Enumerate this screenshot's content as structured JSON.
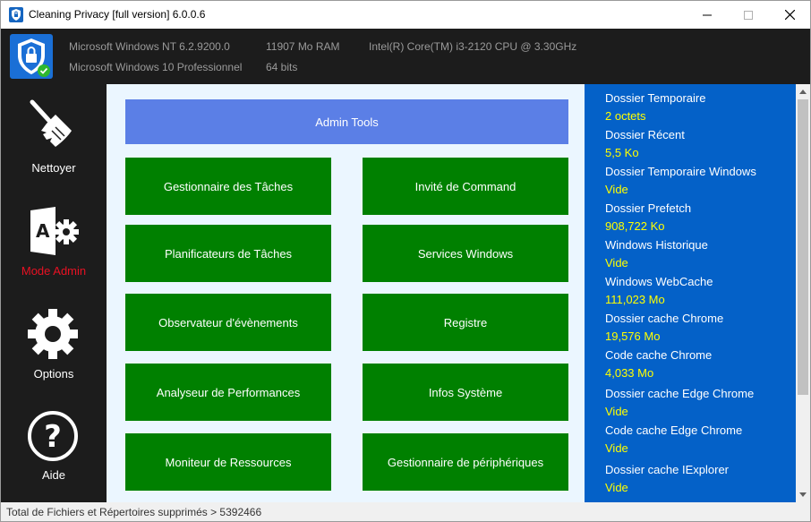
{
  "window": {
    "title": "Cleaning Privacy [full version] 6.0.0.6"
  },
  "header": {
    "os_name": "Microsoft Windows NT 6.2.9200.0",
    "os_edition": "Microsoft Windows 10 Professionnel",
    "ram": "11907 Mo RAM",
    "arch": "64 bits",
    "cpu": "Intel(R) Core(TM) i3-2120 CPU @ 3.30GHz"
  },
  "sidebar": {
    "items": [
      {
        "label": "Nettoyer",
        "icon": "broom-icon",
        "active": false
      },
      {
        "label": "Mode Admin",
        "icon": "admin-icon",
        "active": true
      },
      {
        "label": "Options",
        "icon": "gear-icon",
        "active": false
      },
      {
        "label": "Aide",
        "icon": "help-icon",
        "active": false
      }
    ]
  },
  "main": {
    "admin_tools_label": "Admin Tools",
    "buttons": [
      "Gestionnaire des Tâches",
      "Invité de Command",
      "Planificateurs de Tâches",
      "Services Windows",
      "Observateur d'évènements",
      "Registre",
      "Analyseur de Performances",
      "Infos Système",
      "Moniteur de Ressources",
      "Gestionnaire de périphériques"
    ]
  },
  "panel": {
    "items": [
      {
        "name": "Dossier Temporaire",
        "value": "2 octets"
      },
      {
        "name": "Dossier Récent",
        "value": "5,5 Ko"
      },
      {
        "name": "Dossier Temporaire Windows",
        "value": "Vide"
      },
      {
        "name": "Dossier Prefetch",
        "value": "908,722 Ko"
      },
      {
        "name": "Windows Historique",
        "value": "Vide"
      },
      {
        "name": "Windows WebCache",
        "value": "111,023 Mo"
      },
      {
        "name": "Dossier cache Chrome",
        "value": "19,576 Mo"
      },
      {
        "name": "Code cache Chrome",
        "value": "4,033 Mo"
      },
      {
        "name": "Dossier cache Edge Chrome",
        "value": "Vide"
      },
      {
        "name": "Code cache Edge Chrome",
        "value": "Vide"
      },
      {
        "name": "Dossier cache IExplorer",
        "value": "Vide"
      }
    ]
  },
  "status": {
    "text": "Total de Fichiers et Répertoires supprimés > 5392466"
  },
  "colors": {
    "sidebar_bg": "#1c1c1c",
    "active_nav": "#e81123",
    "button_green": "#008000",
    "admin_tools_blue": "#5b7fe6",
    "panel_blue": "#0461c8",
    "panel_value": "#ffff00",
    "main_bg": "#ebf6ff"
  }
}
